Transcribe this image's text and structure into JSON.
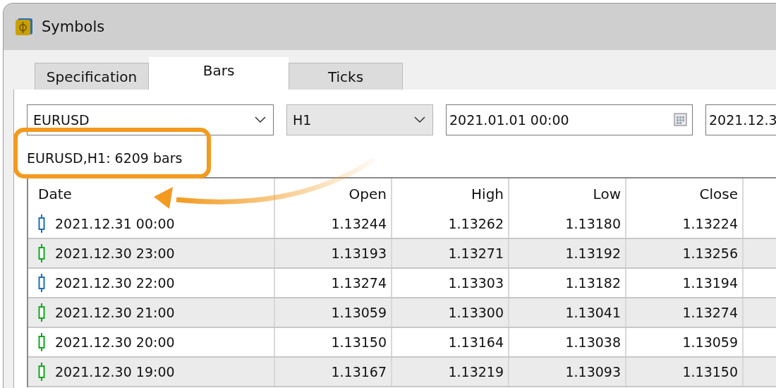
{
  "window": {
    "title": "Symbols"
  },
  "tabs": [
    {
      "label": "Specification",
      "selected": false
    },
    {
      "label": "Bars",
      "selected": true
    },
    {
      "label": "Ticks",
      "selected": false
    }
  ],
  "filters": {
    "symbol": "EURUSD",
    "timeframe": "H1",
    "date_from": "2021.01.01 00:00",
    "date_to": "2021.12.3"
  },
  "summary": "EURUSD,H1: 6209 bars",
  "table": {
    "columns": [
      "Date",
      "Open",
      "High",
      "Low",
      "Close"
    ],
    "rows": [
      {
        "color": "#1f6fb5",
        "cells": [
          "2021.12.31 00:00",
          "1.13244",
          "1.13262",
          "1.13180",
          "1.13224"
        ]
      },
      {
        "color": "#13a81e",
        "cells": [
          "2021.12.30 23:00",
          "1.13193",
          "1.13271",
          "1.13192",
          "1.13256"
        ]
      },
      {
        "color": "#1f6fb5",
        "cells": [
          "2021.12.30 22:00",
          "1.13274",
          "1.13303",
          "1.13182",
          "1.13194"
        ]
      },
      {
        "color": "#13a81e",
        "cells": [
          "2021.12.30 21:00",
          "1.13059",
          "1.13300",
          "1.13041",
          "1.13274"
        ]
      },
      {
        "color": "#13a81e",
        "cells": [
          "2021.12.30 20:00",
          "1.13150",
          "1.13164",
          "1.13038",
          "1.13059"
        ]
      },
      {
        "color": "#13a81e",
        "cells": [
          "2021.12.30 19:00",
          "1.13167",
          "1.13219",
          "1.13093",
          "1.13150"
        ]
      }
    ]
  }
}
